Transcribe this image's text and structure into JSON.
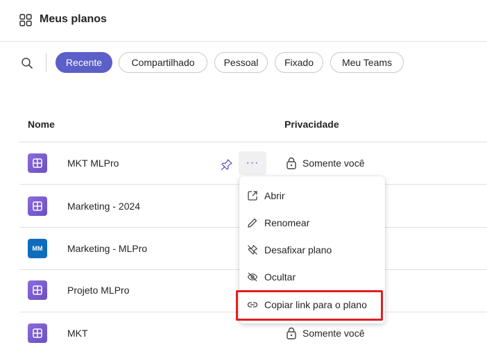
{
  "header": {
    "title": "Meus planos",
    "icon": "grid-icon"
  },
  "filters": [
    {
      "label": "Recente",
      "active": true
    },
    {
      "label": "Compartilhado",
      "active": false
    },
    {
      "label": "Pessoal",
      "active": false
    },
    {
      "label": "Fixado",
      "active": false
    },
    {
      "label": "Meu Teams",
      "active": false
    }
  ],
  "table": {
    "columns": [
      "Nome",
      "Privacidade"
    ],
    "rows": [
      {
        "name": "MKT MLPro",
        "icon": "planner-icon",
        "privacy": "Somente você"
      },
      {
        "name": "Marketing - 2024",
        "icon": "planner-icon",
        "privacy": ""
      },
      {
        "name": "Marketing - MLPro",
        "icon": "MM",
        "privacy": ""
      },
      {
        "name": "Projeto MLPro",
        "icon": "planner-icon",
        "privacy": ""
      },
      {
        "name": "MKT",
        "icon": "planner-icon",
        "privacy": "Somente você"
      }
    ]
  },
  "more_button": {
    "label": "···"
  },
  "context_menu": {
    "items": [
      {
        "label": "Abrir",
        "icon": "open-external-icon"
      },
      {
        "label": "Renomear",
        "icon": "pencil-icon"
      },
      {
        "label": "Desafixar plano",
        "icon": "unpin-icon"
      },
      {
        "label": "Ocultar",
        "icon": "eye-off-icon"
      },
      {
        "label": "Copiar link para o plano",
        "icon": "link-icon",
        "highlighted": true
      }
    ]
  },
  "colors": {
    "accent": "#5b5fc7",
    "highlight_border": "#e01e1e",
    "plan_icon": "#7b5fd0",
    "mm_icon": "#0f6cbd"
  }
}
